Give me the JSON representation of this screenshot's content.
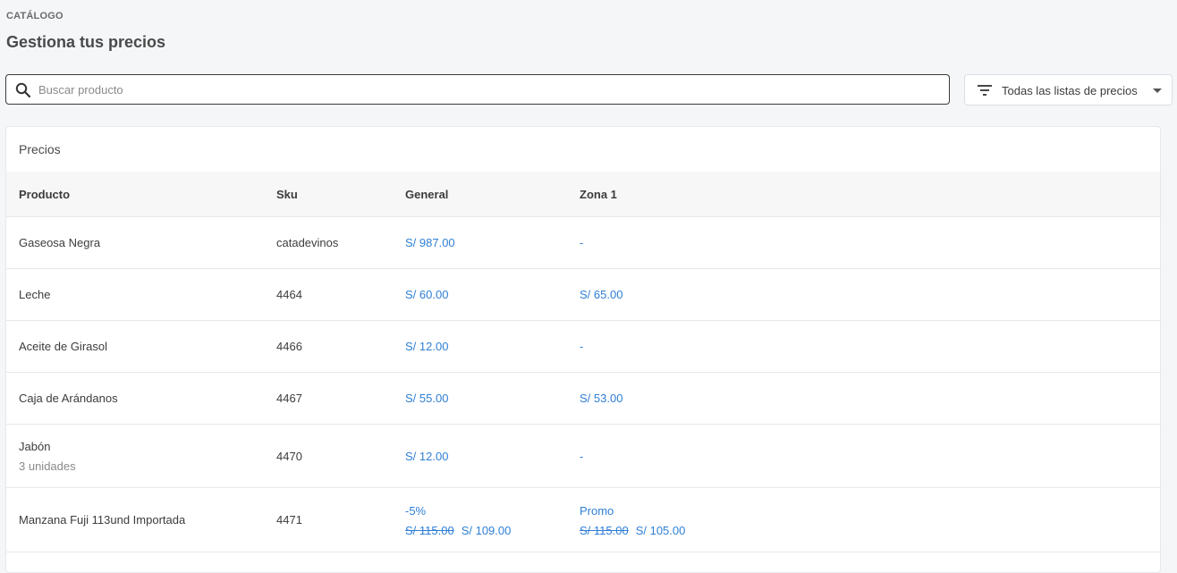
{
  "header": {
    "eyebrow": "CATÁLOGO",
    "title": "Gestiona tus precios"
  },
  "search": {
    "placeholder": "Buscar producto",
    "value": ""
  },
  "filter": {
    "label": "Todas las listas de precios"
  },
  "card": {
    "title": "Precios"
  },
  "table": {
    "columns": [
      "Producto",
      "Sku",
      "General",
      "Zona 1"
    ],
    "rows": [
      {
        "product": "Gaseosa Negra",
        "sku": "catadevinos",
        "general": "S/ 987.00",
        "zona1": "-"
      },
      {
        "product": "Leche",
        "sku": "4464",
        "general": "S/ 60.00",
        "zona1": "S/ 65.00"
      },
      {
        "product": "Aceite de Girasol",
        "sku": "4466",
        "general": "S/ 12.00",
        "zona1": "-"
      },
      {
        "product": "Caja de Arándanos",
        "sku": "4467",
        "general": "S/ 55.00",
        "zona1": "S/ 53.00"
      },
      {
        "product": "Jabón",
        "product_sub": "3 unidades",
        "sku": "4470",
        "general": "S/ 12.00",
        "zona1": "-"
      },
      {
        "product": "Manzana Fuji 113und Importada",
        "sku": "4471",
        "general_tag": "-5%",
        "general_old": "S/ 115.00",
        "general_new": "S/ 109.00",
        "zona1_tag": "Promo",
        "zona1_old": "S/ 115.00",
        "zona1_new": "S/ 105.00"
      }
    ]
  },
  "colors": {
    "accent": "#2f7fd6",
    "background": "#f4f6f8"
  }
}
